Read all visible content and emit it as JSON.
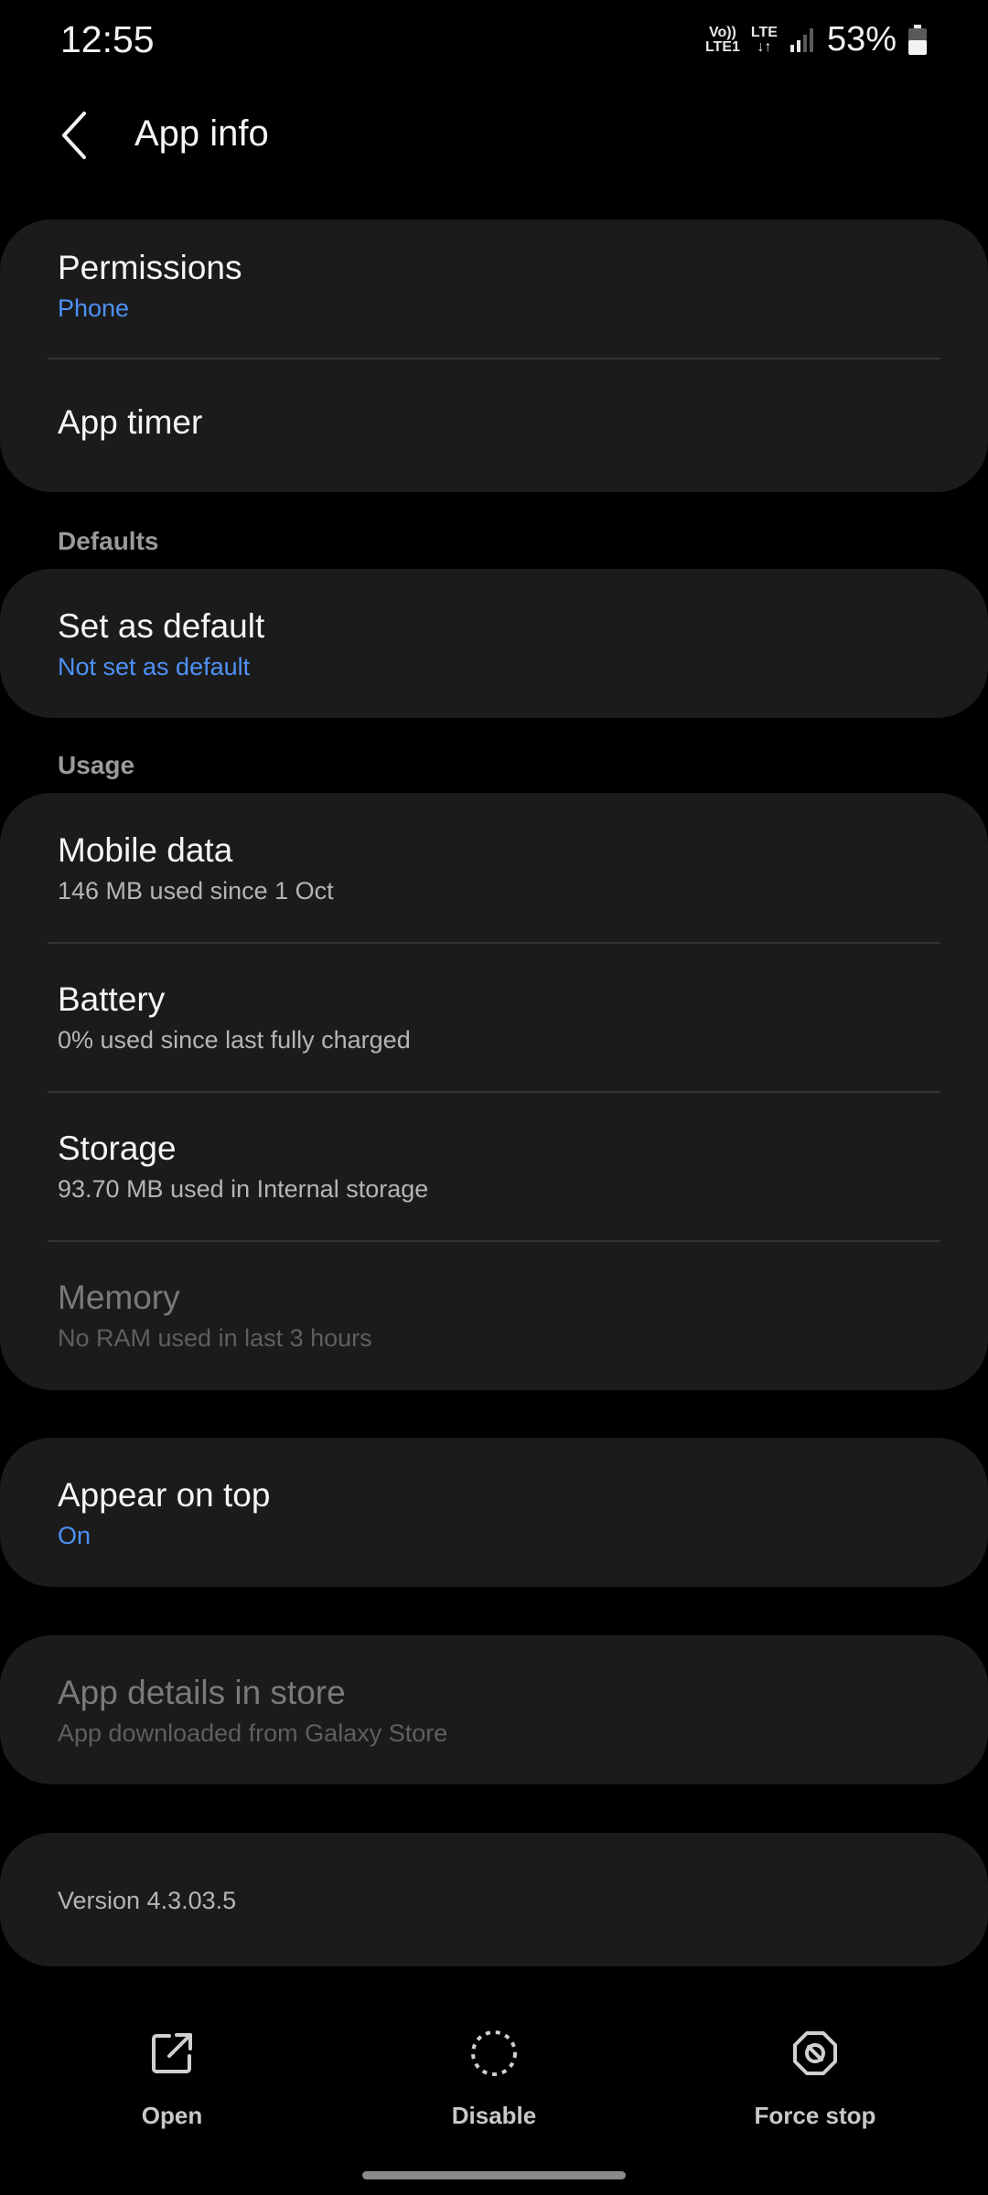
{
  "status_bar": {
    "time": "12:55",
    "volte_top": "Vo))",
    "volte_bottom": "LTE1",
    "lte_top": "LTE",
    "lte_bottom": "↓↑",
    "battery": "53%"
  },
  "header": {
    "title": "App info"
  },
  "permissions": {
    "title": "Permissions",
    "subtitle": "Phone"
  },
  "app_timer": {
    "title": "App timer"
  },
  "defaults_label": "Defaults",
  "set_default": {
    "title": "Set as default",
    "subtitle": "Not set as default"
  },
  "usage_label": "Usage",
  "mobile_data": {
    "title": "Mobile data",
    "subtitle": "146 MB used since 1 Oct"
  },
  "battery": {
    "title": "Battery",
    "subtitle": "0% used since last fully charged"
  },
  "storage": {
    "title": "Storage",
    "subtitle": "93.70 MB used in Internal storage"
  },
  "memory": {
    "title": "Memory",
    "subtitle": "No RAM used in last 3 hours"
  },
  "appear_on_top": {
    "title": "Appear on top",
    "subtitle": "On"
  },
  "store": {
    "title": "App details in store",
    "subtitle": "App downloaded from Galaxy Store"
  },
  "version": "Version 4.3.03.5",
  "actions": {
    "open": "Open",
    "disable": "Disable",
    "force_stop": "Force stop"
  },
  "colors": {
    "accent": "#4e91f6",
    "card": "#1b1b1b",
    "background": "#000000"
  }
}
